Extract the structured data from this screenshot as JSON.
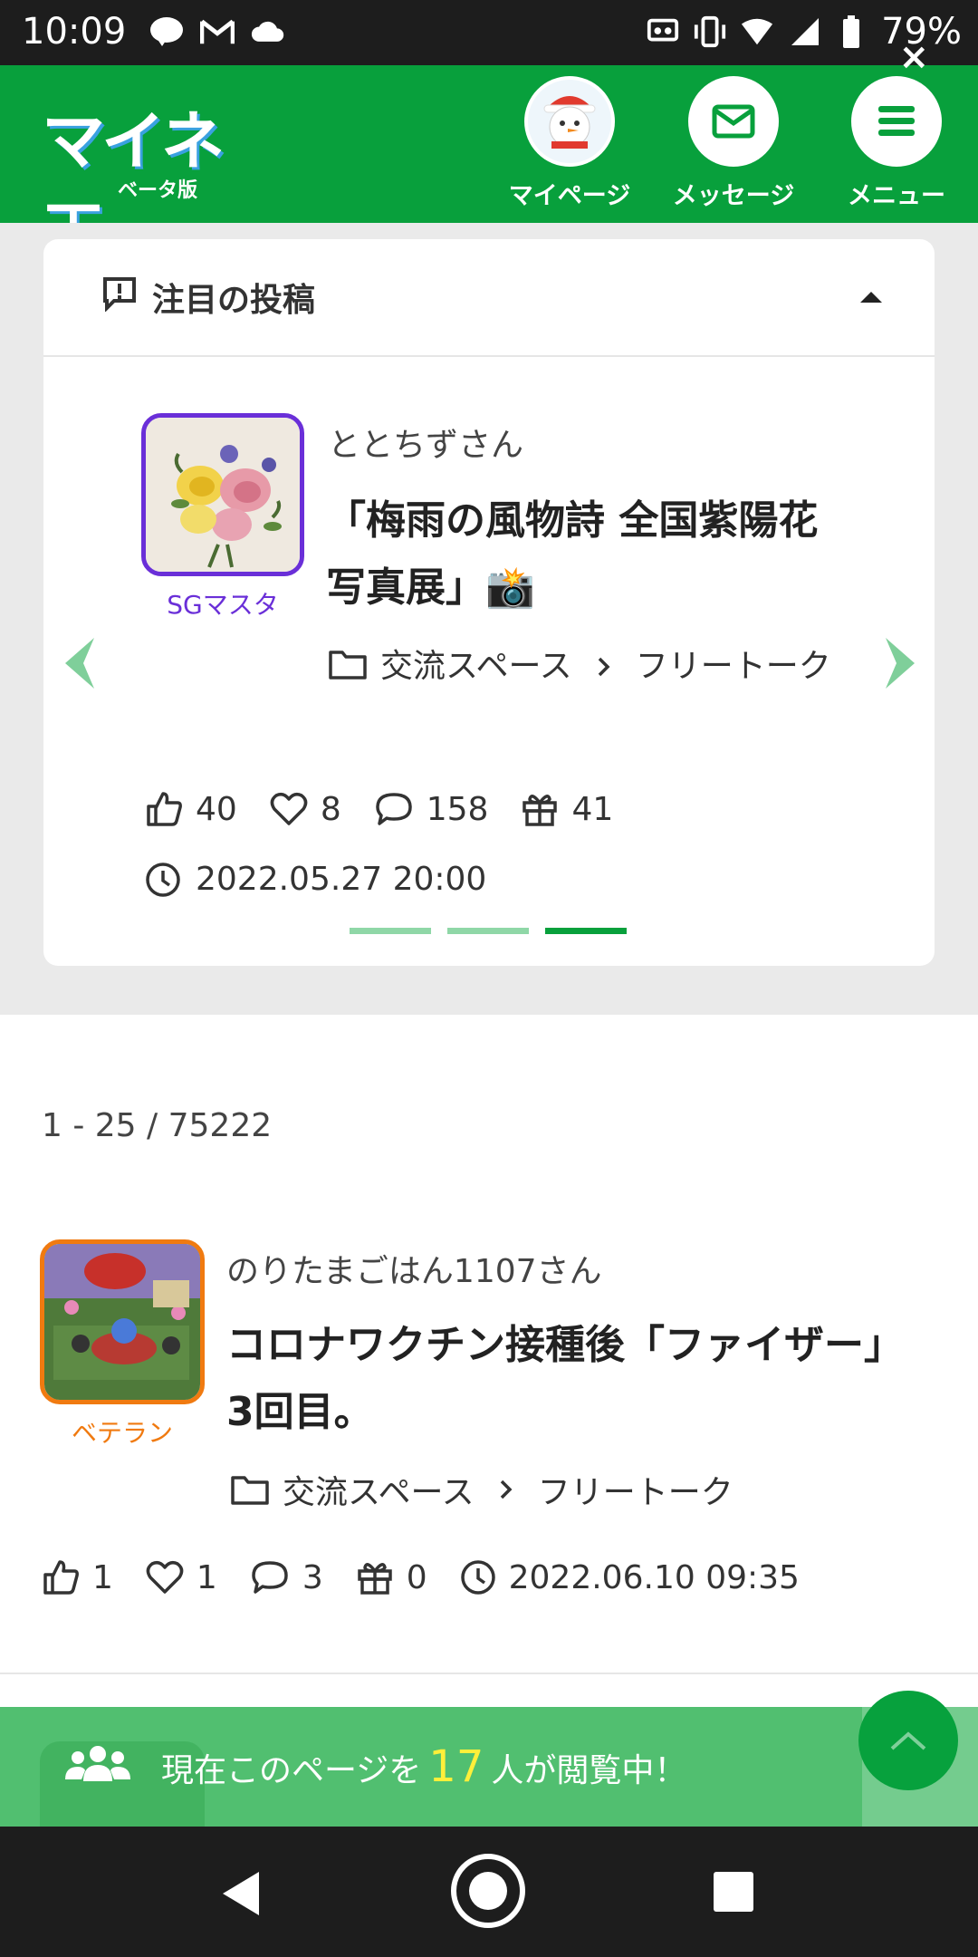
{
  "status_bar": {
    "time": "10:09",
    "battery": "79%"
  },
  "header": {
    "logo_text": "マイネ王",
    "logo_sub": "ベータ版",
    "nav": [
      {
        "label": "マイページ"
      },
      {
        "label": "メッセージ"
      },
      {
        "label": "メニュー"
      }
    ]
  },
  "featured": {
    "section_title": "注目の投稿",
    "post": {
      "user": "ととちずさん",
      "badge": "SGマスタ",
      "title": "「梅雨の風物詩 全国紫陽花写真展」📸",
      "category": "交流スペース",
      "subcategory": "フリートーク",
      "likes": "40",
      "hearts": "8",
      "comments": "158",
      "gifts": "41",
      "date": "2022.05.27 20:00"
    },
    "pager": {
      "total": 3,
      "active": 3
    }
  },
  "results": {
    "count_text": "1 - 25 / 75222"
  },
  "posts": [
    {
      "user": "のりたまごはん1107さん",
      "badge": "ベテラン",
      "title": "コロナワクチン接種後「ファイザー」3回目。",
      "category": "交流スペース",
      "subcategory": "フリートーク",
      "likes": "1",
      "hearts": "1",
      "comments": "3",
      "gifts": "0",
      "date": "2022.06.10 09:35"
    }
  ],
  "viewer_banner": {
    "prefix": "現在このページを",
    "count": "17",
    "suffix": "人が閲覧中！",
    "close": "×"
  },
  "colors": {
    "brand_green": "#08a03c",
    "badge_purple": "#6a2fd8",
    "badge_orange": "#f07a10"
  }
}
